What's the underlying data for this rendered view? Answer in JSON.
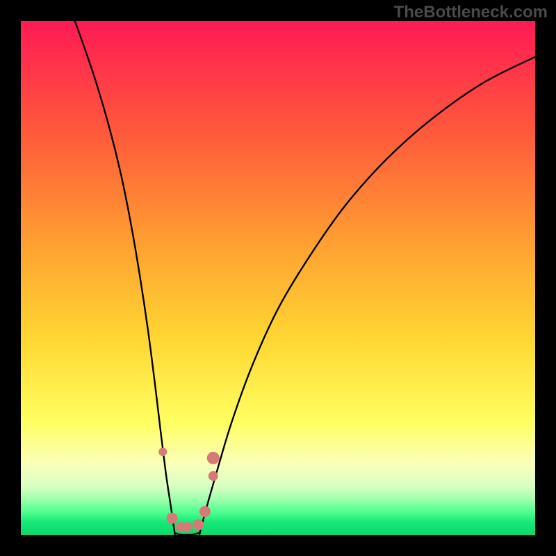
{
  "watermark": "TheBottleneck.com",
  "chart_data": {
    "type": "line",
    "title": "",
    "xlabel": "",
    "ylabel": "",
    "xlim": [
      0,
      100
    ],
    "ylim": [
      0,
      100
    ],
    "gradient_stops": [
      {
        "offset": 0,
        "color": "#ff1a55"
      },
      {
        "offset": 0.22,
        "color": "#ff5a3a"
      },
      {
        "offset": 0.45,
        "color": "#ffa531"
      },
      {
        "offset": 0.62,
        "color": "#ffd733"
      },
      {
        "offset": 0.78,
        "color": "#ffff61"
      },
      {
        "offset": 0.86,
        "color": "#faffb8"
      },
      {
        "offset": 0.905,
        "color": "#d9ffc2"
      },
      {
        "offset": 0.93,
        "color": "#9fffad"
      },
      {
        "offset": 0.955,
        "color": "#4fff8f"
      },
      {
        "offset": 0.975,
        "color": "#17e877"
      },
      {
        "offset": 1.0,
        "color": "#0cd869"
      }
    ],
    "series": [
      {
        "name": "left-branch",
        "x_plot": [
          10.5,
          14.0,
          17.0,
          19.5,
          21.5,
          23.2,
          24.7,
          26.0,
          27.2,
          28.2,
          29.1,
          29.9
        ],
        "y_plot": [
          100,
          90,
          80,
          70,
          60,
          50,
          40,
          30,
          20,
          12,
          6,
          0.5
        ]
      },
      {
        "name": "right-branch",
        "x_plot": [
          34.8,
          36.0,
          38.0,
          41.0,
          45.0,
          50.0,
          56.0,
          63.0,
          71.0,
          80.0,
          90.0,
          100.0
        ],
        "y_plot": [
          0.5,
          5,
          12,
          22,
          33,
          44,
          54,
          64,
          73,
          81,
          88,
          93
        ]
      },
      {
        "name": "valley-floor",
        "x_plot": [
          29.9,
          30.5,
          31.5,
          32.5,
          33.5,
          34.2,
          34.8
        ],
        "y_plot": [
          0.5,
          0.2,
          0.1,
          0.1,
          0.15,
          0.3,
          0.5
        ]
      }
    ],
    "markers": [
      {
        "x_plot": 27.6,
        "y_plot": 16.2,
        "r": 6
      },
      {
        "x_plot": 29.4,
        "y_plot": 3.3,
        "r": 8
      },
      {
        "x_plot": 31.1,
        "y_plot": 1.6,
        "r": 7
      },
      {
        "x_plot": 32.4,
        "y_plot": 1.6,
        "r": 7
      },
      {
        "x_plot": 34.5,
        "y_plot": 2.0,
        "r": 8
      },
      {
        "x_plot": 35.8,
        "y_plot": 4.6,
        "r": 8
      },
      {
        "x_plot": 37.4,
        "y_plot": 15.0,
        "r": 9
      },
      {
        "x_plot": 37.4,
        "y_plot": 11.5,
        "r": 7
      }
    ],
    "marker_color": "#d77a77",
    "curve_color": "#000000",
    "curve_width": 2.4
  }
}
